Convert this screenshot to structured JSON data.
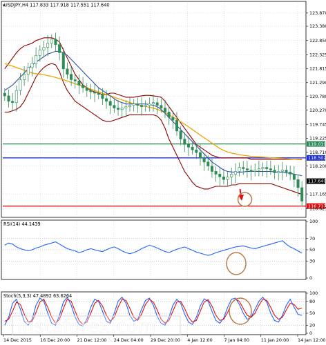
{
  "chart_data": [
    {
      "type": "candlestick",
      "title": "USDJPY,H4  117.833 117.918 117.551 117.640",
      "symbol": "USDJPY",
      "timeframe": "H4",
      "ohlc_current": {
        "open": 117.833,
        "high": 117.918,
        "low": 117.551,
        "close": 117.64
      },
      "y_ticks": [
        "123.870",
        "123.380",
        "122.850",
        "122.325",
        "121.815",
        "121.290",
        "120.780",
        "120.270",
        "119.745",
        "119.225",
        "118.710",
        "118.200",
        "117.165",
        "116.625"
      ],
      "ylim": [
        116.35,
        124.25
      ],
      "x_labels": [
        "14 Dec 2015",
        "16 Dec 20:00",
        "21 Dec 12:00",
        "24 Dec 04:00",
        "29 Dec 20:00",
        "4 Jan 12:00",
        "7 Jan 04:00",
        "11 Jan 20:00",
        "14 Jan 12:00"
      ],
      "horizontal_levels": [
        {
          "value": 119.019,
          "label": "119.019",
          "color": "#2e8b57"
        },
        {
          "value": 118.502,
          "label": "118.502",
          "color": "#1f2fd6"
        },
        {
          "value": 117.64,
          "label": "117.640",
          "color": "#000000"
        },
        {
          "value": 116.717,
          "label": "116.717",
          "color": "#e01010"
        }
      ],
      "series_colors": {
        "candles": "#2e8b57",
        "bollinger": "#8b0000",
        "ma_fast": "#2e4fa0",
        "ma_slow": "#f0a400"
      },
      "candles_close": [
        120.8,
        120.6,
        120.55,
        121.0,
        121.4,
        121.6,
        121.85,
        122.0,
        122.3,
        122.5,
        122.6,
        122.75,
        122.9,
        122.7,
        122.4,
        121.8,
        121.6,
        121.4,
        121.35,
        121.2,
        121.1,
        121.0,
        120.95,
        120.9,
        120.85,
        120.7,
        120.6,
        120.45,
        120.35,
        120.3,
        120.35,
        120.4,
        120.45,
        120.5,
        120.45,
        120.4,
        120.45,
        120.5,
        120.55,
        120.45,
        120.35,
        120.2,
        120.0,
        119.9,
        119.5,
        119.2,
        119.0,
        118.9,
        118.8,
        118.7,
        118.5,
        118.35,
        118.2,
        118.0,
        117.9,
        117.8,
        117.7,
        117.8,
        117.9,
        118.0,
        118.15,
        118.1,
        118.05,
        118.0,
        118.05,
        118.1,
        118.15,
        118.1,
        118.05,
        117.95,
        118.0,
        118.05,
        117.98,
        117.9,
        117.7,
        117.4,
        116.9
      ],
      "bollinger_upper": [
        121.8,
        122.0,
        122.2,
        122.4,
        122.55,
        122.65,
        122.7,
        122.75,
        122.85,
        122.9,
        122.95,
        122.95,
        122.95,
        122.9,
        122.8,
        122.5,
        122.2,
        121.9,
        121.6,
        121.4,
        121.2,
        121.1,
        121.0,
        120.95,
        120.9,
        120.85,
        120.85,
        120.9,
        120.9,
        120.85,
        120.8,
        120.75,
        120.75,
        120.75,
        120.78,
        120.8,
        120.82,
        120.82,
        120.8,
        120.78,
        120.75,
        120.6,
        120.4,
        120.2,
        120.0,
        119.8,
        119.6,
        119.4,
        119.2,
        119.0,
        118.9,
        118.8,
        118.7,
        118.6,
        118.55,
        118.5,
        118.5,
        118.5,
        118.5,
        118.5,
        118.5,
        118.5,
        118.5,
        118.45,
        118.45,
        118.45,
        118.45,
        118.45,
        118.45,
        118.45,
        118.45,
        118.45,
        118.45,
        118.45,
        118.45,
        118.45,
        118.45
      ],
      "bollinger_lower": [
        120.2,
        120.2,
        120.25,
        120.3,
        120.4,
        120.6,
        120.9,
        121.2,
        121.5,
        121.7,
        121.85,
        121.95,
        122.0,
        121.95,
        121.7,
        121.3,
        121.0,
        120.8,
        120.6,
        120.5,
        120.4,
        120.3,
        120.2,
        120.1,
        120.0,
        119.9,
        119.85,
        119.85,
        119.9,
        119.95,
        120.0,
        120.05,
        120.1,
        120.1,
        120.1,
        120.1,
        120.1,
        120.1,
        120.1,
        120.05,
        119.9,
        119.6,
        119.2,
        118.9,
        118.6,
        118.3,
        118.0,
        117.8,
        117.6,
        117.45,
        117.4,
        117.35,
        117.35,
        117.4,
        117.45,
        117.45,
        117.45,
        117.45,
        117.5,
        117.5,
        117.55,
        117.55,
        117.55,
        117.55,
        117.55,
        117.55,
        117.55,
        117.55,
        117.55,
        117.5,
        117.45,
        117.4,
        117.35,
        117.3,
        117.25,
        117.2,
        117.15
      ],
      "ma_fast": [
        121.0,
        121.1,
        121.2,
        121.35,
        121.5,
        121.65,
        121.8,
        121.95,
        122.05,
        122.15,
        122.25,
        122.35,
        122.4,
        122.45,
        122.45,
        122.4,
        122.3,
        122.15,
        122.0,
        121.85,
        121.7,
        121.55,
        121.4,
        121.25,
        121.1,
        121.0,
        120.9,
        120.8,
        120.7,
        120.6,
        120.55,
        120.5,
        120.5,
        120.5,
        120.5,
        120.5,
        120.5,
        120.48,
        120.45,
        120.4,
        120.3,
        120.15,
        120.0,
        119.85,
        119.7,
        119.55,
        119.4,
        119.25,
        119.1,
        118.95,
        118.8,
        118.65,
        118.5,
        118.35,
        118.25,
        118.15,
        118.05,
        118.0,
        117.98,
        117.97,
        117.97,
        117.98,
        118.0,
        118.0,
        118.0,
        118.0,
        118.0,
        118.0,
        118.0,
        117.98,
        117.97,
        117.96,
        117.95,
        117.93,
        117.9,
        117.87,
        117.84
      ],
      "ma_slow": [
        122.0,
        121.95,
        121.9,
        121.85,
        121.8,
        121.75,
        121.7,
        121.65,
        121.62,
        121.6,
        121.58,
        121.55,
        121.52,
        121.48,
        121.44,
        121.4,
        121.35,
        121.3,
        121.25,
        121.2,
        121.15,
        121.1,
        121.05,
        121.0,
        120.95,
        120.9,
        120.85,
        120.8,
        120.75,
        120.7,
        120.65,
        120.6,
        120.55,
        120.5,
        120.47,
        120.44,
        120.41,
        120.38,
        120.35,
        120.3,
        120.24,
        120.18,
        120.1,
        120.02,
        119.93,
        119.84,
        119.75,
        119.65,
        119.55,
        119.45,
        119.35,
        119.25,
        119.15,
        119.05,
        118.95,
        118.85,
        118.78,
        118.72,
        118.68,
        118.65,
        118.62,
        118.6,
        118.58,
        118.56,
        118.55,
        118.54,
        118.53,
        118.52,
        118.51,
        118.5,
        118.49,
        118.48,
        118.47,
        118.46,
        118.45,
        118.44,
        118.43
      ],
      "annotations": [
        "down-arrow",
        "target-circle"
      ]
    },
    {
      "type": "line",
      "title": "RSI(14) 44.1439",
      "y_ticks": [
        "100",
        "70",
        "50",
        "30",
        "0"
      ],
      "ylim": [
        0,
        100
      ],
      "levels": [
        70,
        50,
        30
      ],
      "series": [
        {
          "color": "#2060ff",
          "values": [
            58,
            62,
            60,
            55,
            52,
            50,
            48,
            50,
            53,
            55,
            58,
            60,
            62,
            64,
            60,
            56,
            52,
            50,
            48,
            45,
            47,
            50,
            52,
            50,
            48,
            47,
            50,
            53,
            55,
            52,
            48,
            45,
            43,
            45,
            48,
            52,
            55,
            58,
            56,
            53,
            50,
            47,
            45,
            48,
            51,
            53,
            55,
            52,
            49,
            46,
            44,
            42,
            40,
            42,
            45,
            47,
            49,
            51,
            53,
            55,
            56,
            57,
            55,
            53,
            52,
            54,
            56,
            58,
            60,
            62,
            64,
            66,
            60,
            55,
            52,
            48,
            44
          ]
        }
      ],
      "annotations": [
        "target-circle"
      ]
    },
    {
      "type": "line",
      "title": "Stoch(5,3,3) 47.4892 63.6264",
      "y_ticks": [
        "100",
        "80",
        "50",
        "20",
        "0"
      ],
      "ylim": [
        0,
        100
      ],
      "levels": [
        80,
        50,
        20
      ],
      "series": [
        {
          "color": "#2060ff",
          "values": [
            20,
            40,
            75,
            85,
            60,
            30,
            20,
            35,
            70,
            88,
            80,
            50,
            25,
            20,
            45,
            78,
            90,
            70,
            40,
            22,
            18,
            35,
            65,
            85,
            80,
            55,
            30,
            25,
            50,
            80,
            90,
            75,
            45,
            30,
            35,
            60,
            82,
            88,
            70,
            42,
            25,
            20,
            40,
            70,
            85,
            75,
            48,
            28,
            22,
            40,
            68,
            86,
            80,
            55,
            32,
            25,
            38,
            65,
            85,
            88,
            72,
            50,
            35,
            40,
            60,
            80,
            90,
            78,
            50,
            32,
            28,
            45,
            70,
            85,
            65,
            47,
            45
          ]
        },
        {
          "color": "#e01010",
          "values": [
            30,
            35,
            55,
            78,
            72,
            48,
            28,
            30,
            52,
            78,
            85,
            65,
            40,
            25,
            35,
            62,
            85,
            80,
            55,
            32,
            22,
            28,
            50,
            75,
            82,
            68,
            45,
            30,
            40,
            65,
            85,
            82,
            62,
            40,
            32,
            48,
            72,
            85,
            78,
            58,
            35,
            25,
            32,
            55,
            78,
            80,
            62,
            40,
            28,
            32,
            55,
            78,
            84,
            68,
            45,
            32,
            35,
            52,
            75,
            85,
            80,
            62,
            45,
            40,
            50,
            70,
            85,
            82,
            65,
            45,
            35,
            40,
            58,
            75,
            72,
            60,
            63
          ]
        }
      ],
      "annotations": [
        "target-circle"
      ]
    }
  ],
  "watermark": "instaforex.com",
  "colors": {
    "bg": "#ffffff",
    "grid": "#c8c8c8",
    "border": "#000000",
    "circle": "#b87a4b"
  }
}
